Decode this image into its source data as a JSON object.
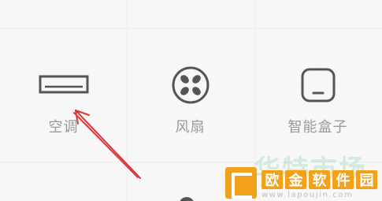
{
  "tiles": [
    {
      "label": "空调",
      "icon": "air-conditioner-icon"
    },
    {
      "label": "风扇",
      "icon": "fan-icon"
    },
    {
      "label": "智能盒子",
      "icon": "smart-box-icon"
    }
  ],
  "watermark": {
    "bg_text": "华特市场",
    "title_chars": [
      "欧",
      "金",
      "软",
      "件",
      "园"
    ],
    "url": "www.lapoujin.com"
  },
  "colors": {
    "background": "#f7f7f7",
    "icon_stroke": "#555555",
    "label": "#9a9a9a",
    "arrow": "#d93a3a",
    "watermark_accent": "#f1a21a"
  }
}
